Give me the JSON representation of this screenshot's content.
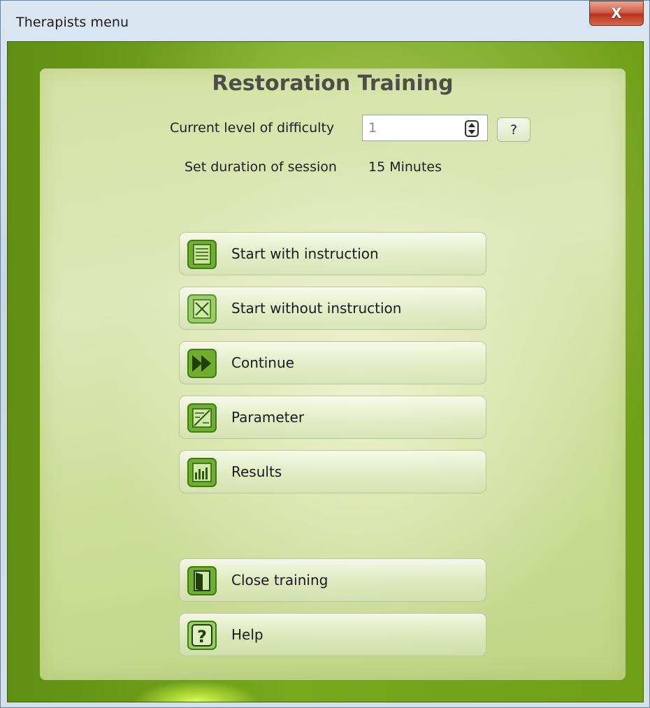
{
  "window": {
    "title": "Therapists menu",
    "close_glyph": "X"
  },
  "heading": "Restoration Training",
  "difficulty": {
    "label": "Current level of difficulty",
    "value": "1",
    "help_label": "?"
  },
  "duration": {
    "label": "Set duration of session",
    "value": "15 Minutes"
  },
  "buttons": {
    "start_with_instruction": {
      "label": "Start with instruction",
      "icon": "document-lines-icon"
    },
    "start_without_instruction": {
      "label": "Start without instruction",
      "icon": "document-crossed-icon"
    },
    "continue": {
      "label": "Continue",
      "icon": "fast-forward-icon"
    },
    "parameter": {
      "label": "Parameter",
      "icon": "parameter-icon"
    },
    "results": {
      "label": "Results",
      "icon": "bar-chart-icon"
    },
    "close_training": {
      "label": "Close training",
      "icon": "exit-door-icon"
    },
    "help": {
      "label": "Help",
      "icon": "question-mark-icon"
    }
  },
  "colors": {
    "accent_green": "#78a81c",
    "icon_green": "#6fae2f",
    "close_red": "#c4402a"
  }
}
